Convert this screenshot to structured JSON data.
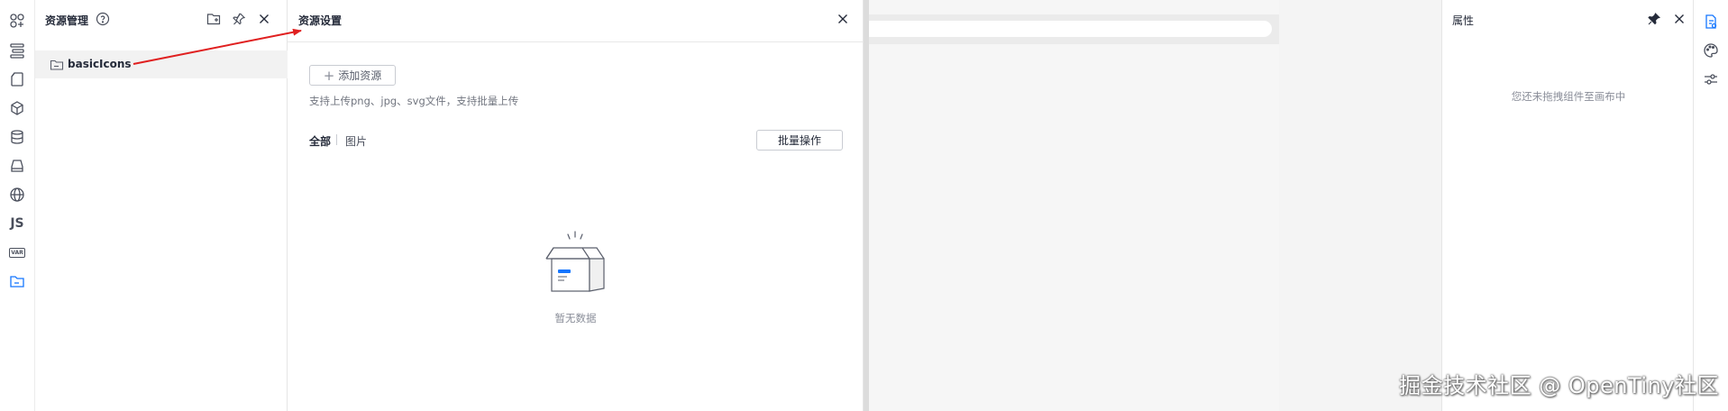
{
  "left_rail": {
    "icons": [
      "components-icon",
      "outline-icon",
      "page-icon",
      "block-icon",
      "datasource-icon",
      "bridge-icon",
      "i18n-icon",
      "js-icon",
      "var-icon",
      "resources-folder-icon"
    ],
    "js_label": "JS",
    "var_label": "VAR"
  },
  "resource_panel": {
    "title": "资源管理",
    "folders": [
      {
        "label": "basicIcons"
      }
    ]
  },
  "settings_panel": {
    "title": "资源设置",
    "add_button": "添加资源",
    "hint": "支持上传png、jpg、svg文件，支持批量上传",
    "tabs": [
      {
        "label": "全部",
        "active": true
      },
      {
        "label": "图片",
        "active": false
      }
    ],
    "batch_button": "批量操作",
    "empty_text": "暂无数据"
  },
  "properties_panel": {
    "title": "属性",
    "empty_text": "您还未拖拽组件至画布中"
  },
  "right_rail": {
    "icons": [
      "props-icon",
      "style-icon",
      "advanced-icon"
    ]
  },
  "watermark": "掘金技术社区 @ OpenTiny社区",
  "colors": {
    "arrow": "#e02020",
    "active_icon": "#1476ff",
    "panel_bg": "#ffffff",
    "canvas_bg": "#f6f6f6"
  }
}
